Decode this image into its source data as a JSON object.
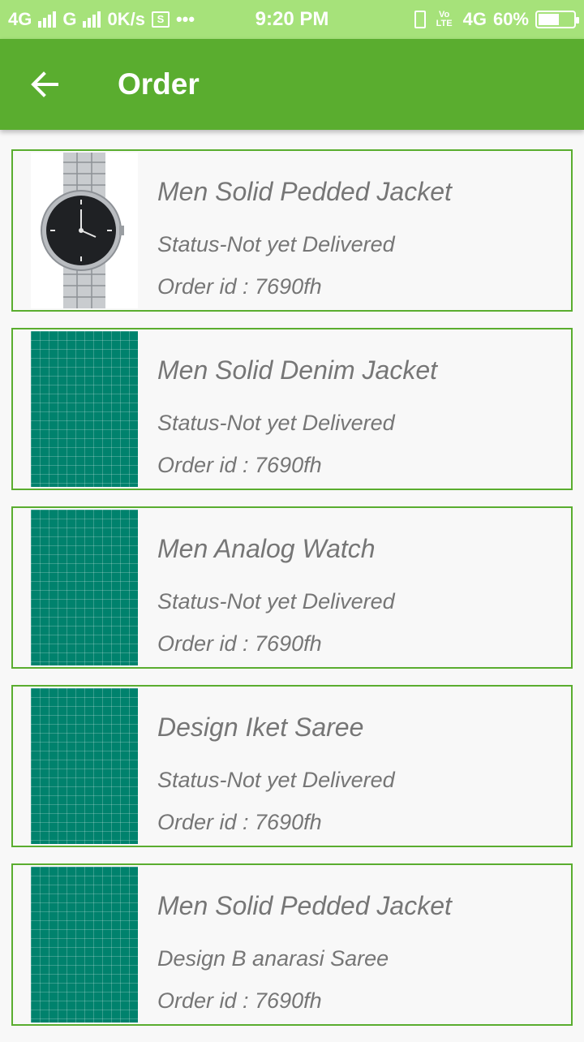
{
  "status_bar": {
    "net1": "4G",
    "net2": "G",
    "speed": "0K/s",
    "dots": "•••",
    "time": "9:20 PM",
    "volte": "Vo LTE",
    "net3": "4G",
    "battery": "60%",
    "battery_level": 0.6
  },
  "header": {
    "back_icon": "arrow-left-icon",
    "title": "Order"
  },
  "orders": [
    {
      "image": "watch",
      "name": "Men Solid Pedded Jacket",
      "status": "Status-Not yet Delivered",
      "order_id": "Order id : 7690fh"
    },
    {
      "image": "placeholder",
      "name": "Men Solid Denim Jacket",
      "status": "Status-Not yet Delivered",
      "order_id": "Order id : 7690fh"
    },
    {
      "image": "placeholder",
      "name": "Men Analog Watch",
      "status": "Status-Not yet Delivered",
      "order_id": "Order id : 7690fh"
    },
    {
      "image": "placeholder",
      "name": "Design Iket Saree",
      "status": "Status-Not yet Delivered",
      "order_id": "Order id : 7690fh"
    },
    {
      "image": "placeholder",
      "name": "Men Solid Pedded Jacket",
      "status": "Design B anarasi Saree",
      "order_id": "Order id : 7690fh"
    }
  ],
  "colors": {
    "status_bar": "#a6e27a",
    "app_bar": "#5aad2f",
    "card_border": "#5aad2f",
    "placeholder": "#00826d",
    "text": "#767676"
  }
}
